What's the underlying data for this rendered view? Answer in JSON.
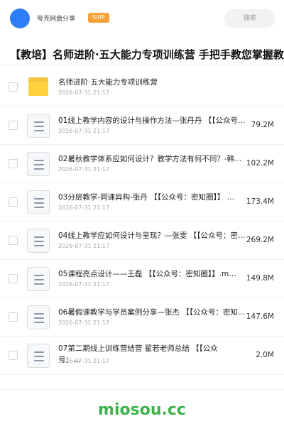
{
  "header": {
    "username": "夸克网盘分享",
    "badge": "SVIP",
    "search_placeholder": "搜索"
  },
  "title": "【教培】名师进阶·五大能力专项训练营 手把手教您掌握教",
  "files": [
    {
      "type": "folder",
      "name": "名师进阶·五大能力专项训练营",
      "date": "2026-07-31 21:17",
      "size": ""
    },
    {
      "type": "file",
      "name": "01线上教学内容的设计与操作方法—张丹丹 【【公众号：密知圈】】.mp4",
      "date": "2026-07-31 21:17",
      "size": "79.2M"
    },
    {
      "type": "file",
      "name": "02暑秋教学体系应如何设计？教学方法有何不同？-韩…",
      "date": "2026-07-31 21:17",
      "size": "102.2M"
    },
    {
      "type": "file",
      "name": "03分层教学-同课异构-张丹 【【公众号：密知圈】】 …",
      "date": "2026-07-31 21:17",
      "size": "173.4M"
    },
    {
      "type": "file",
      "name": "04线上教学应如何设计与呈现？—张雯 【【公众号：密…",
      "date": "2026-07-31 21:17",
      "size": "269.2M"
    },
    {
      "type": "file",
      "name": "05课程亮点设计——王磊 【【公众号：密知圈】】.m…",
      "date": "2026-07-31 21:17",
      "size": "149.8M"
    },
    {
      "type": "file",
      "name": "06暑假课教学与学员案例分享—张杰 【【公众号：密知…",
      "date": "2026-07-31 21:17",
      "size": "147.6M"
    },
    {
      "type": "file",
      "name": "07第二期线上训练营结营 翟若老师总结 【【公众号：…",
      "date": "2026-07-31 21:17",
      "size": "2.0M",
      "multiline": true
    }
  ],
  "footer": {
    "brand": "miosou.cc"
  }
}
